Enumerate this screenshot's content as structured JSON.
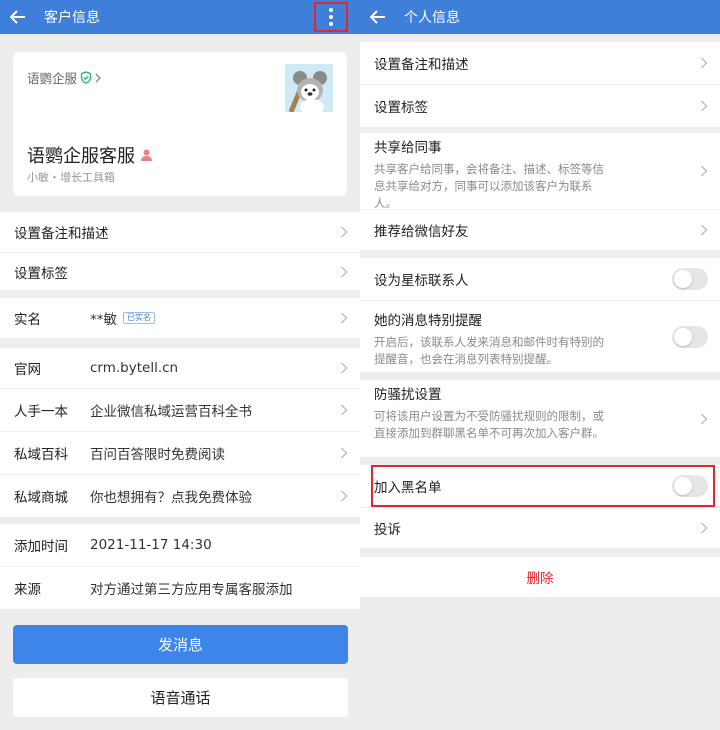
{
  "left": {
    "title": "客户信息",
    "card": {
      "corp_name": "语鹦企服",
      "customer_name": "语鹦企服客服",
      "subtitle": "小敏・增长工具箱"
    },
    "menu": [
      {
        "label": "设置备注和描述"
      },
      {
        "label": "设置标签"
      }
    ],
    "realname": {
      "key": "实名",
      "value": "**敏",
      "badge": "已实名"
    },
    "links": [
      {
        "key": "官网",
        "value": "crm.bytell.cn"
      },
      {
        "key": "人手一本",
        "value": "企业微信私域运营百科全书"
      },
      {
        "key": "私域百科",
        "value": "百问百答限时免费阅读"
      },
      {
        "key": "私域商城",
        "value": "你也想拥有？点我免费体验"
      }
    ],
    "meta": [
      {
        "key": "添加时间",
        "value": "2021-11-17 14:30"
      },
      {
        "key": "来源",
        "value": "对方通过第三方应用专属客服添加"
      }
    ],
    "primary_button": "发消息",
    "secondary_button": "语音通话"
  },
  "right": {
    "title": "个人信息",
    "items": [
      {
        "label": "设置备注和描述"
      },
      {
        "label": "设置标签"
      },
      {
        "label": "共享给同事",
        "desc": "共享客户给同事，会将备注、描述、标签等信息共享给对方，同事可以添加该客户为联系人。"
      },
      {
        "label": "推荐给微信好友"
      },
      {
        "label": "设为星标联系人"
      },
      {
        "label": "她的消息特别提醒",
        "desc": "开启后，该联系人发来消息和邮件时有特别的提醒音，也会在消息列表特别提醒。"
      },
      {
        "label": "防骚扰设置",
        "desc": "可将该用户设置为不受防骚扰规则的限制，或直接添加到群聊黑名单不可再次加入客户群。"
      },
      {
        "label": "加入黑名单"
      },
      {
        "label": "投诉"
      }
    ],
    "toggles": {
      "star": false,
      "special_alert": false,
      "blacklist": false
    },
    "delete_label": "删除"
  },
  "colors": {
    "header": "#3d7fd9",
    "primary_button": "#3d85e8",
    "danger": "#e0262f",
    "verified": "#1fb37a",
    "person": "#f07f7f"
  }
}
